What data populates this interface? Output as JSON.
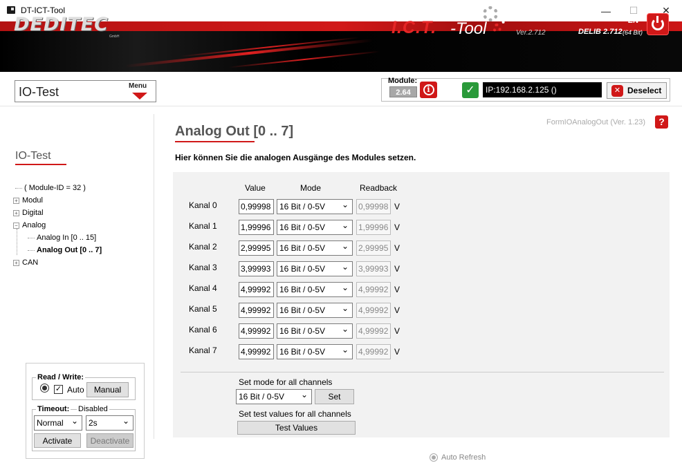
{
  "window": {
    "title": "DT-ICT-Tool",
    "minimize": "—",
    "maximize": "☐",
    "close": "✕"
  },
  "banner": {
    "logo": "DEDITEC",
    "logo_sub": "GmbH",
    "ict": "I.C.T.",
    "tool": "-Tool",
    "version": "Ver.2.712",
    "lang": "EN",
    "delib": "DELIB 2.712",
    "delib_bits": "(64 Bit)"
  },
  "header": {
    "page_box_title": "IO-Test",
    "menu_label": "Menu",
    "module_label": "Module:",
    "module_number": "2.64",
    "ip_text": "IP:192.168.2.125 ()",
    "deselect_label": "Deselect"
  },
  "sidebar": {
    "title": "IO-Test",
    "tree": [
      {
        "label": "( Module-ID = 32 )"
      },
      {
        "label": "Modul"
      },
      {
        "label": "Digital"
      },
      {
        "label": "Analog"
      },
      {
        "label": "Analog In [0 .. 15]"
      },
      {
        "label": "Analog Out [0 .. 7]"
      },
      {
        "label": "CAN"
      }
    ],
    "rw": {
      "title": "Read / Write:",
      "auto_label": "Auto",
      "manual_label": "Manual"
    },
    "timeout": {
      "title": "Timeout:",
      "status": "Disabled",
      "mode_value": "Normal",
      "time_value": "2s",
      "activate_label": "Activate",
      "deactivate_label": "Deactivate"
    }
  },
  "main": {
    "title": "Analog Out [0 .. 7]",
    "form_version": "FormIOAnalogOut (Ver. 1.23)",
    "help": "?",
    "description": "Hier können Sie die analogen Ausgänge des Modules setzen.",
    "columns": {
      "value": "Value",
      "mode": "Mode",
      "readback": "Readback"
    },
    "unit": "V",
    "channels": [
      {
        "label": "Kanal  0",
        "value": "0,99998",
        "mode": "16 Bit / 0-5V",
        "readback": "0,99998"
      },
      {
        "label": "Kanal  1",
        "value": "1,99996",
        "mode": "16 Bit / 0-5V",
        "readback": "1,99996"
      },
      {
        "label": "Kanal  2",
        "value": "2,99995",
        "mode": "16 Bit / 0-5V",
        "readback": "2,99995"
      },
      {
        "label": "Kanal  3",
        "value": "3,99993",
        "mode": "16 Bit / 0-5V",
        "readback": "3,99993"
      },
      {
        "label": "Kanal  4",
        "value": "4,99992",
        "mode": "16 Bit / 0-5V",
        "readback": "4,99992"
      },
      {
        "label": "Kanal  5",
        "value": "4,99992",
        "mode": "16 Bit / 0-5V",
        "readback": "4,99992"
      },
      {
        "label": "Kanal  6",
        "value": "4,99992",
        "mode": "16 Bit / 0-5V",
        "readback": "4,99992"
      },
      {
        "label": "Kanal  7",
        "value": "4,99992",
        "mode": "16 Bit / 0-5V",
        "readback": "4,99992"
      }
    ],
    "set_mode_label": "Set mode for all channels",
    "set_mode_value": "16 Bit / 0-5V",
    "set_button": "Set",
    "test_values_label": "Set test values for all channels",
    "test_values_button": "Test Values",
    "auto_refresh": "Auto Refresh"
  }
}
